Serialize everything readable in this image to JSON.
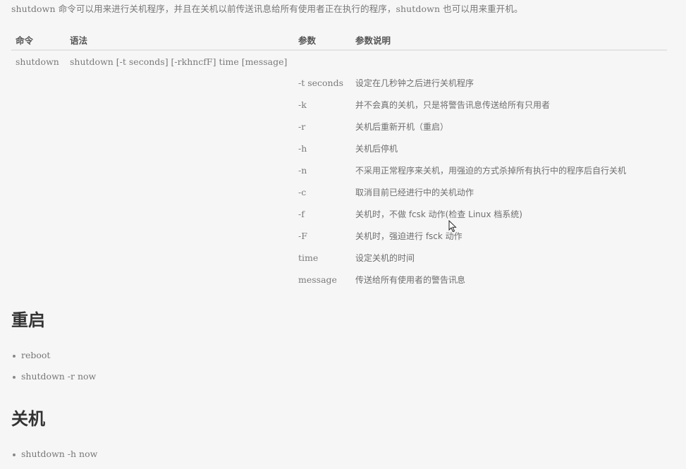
{
  "intro": "shutdown 命令可以用来进行关机程序，并且在关机以前传送讯息给所有使用者正在执行的程序，shutdown 也可以用来重开机。",
  "table": {
    "headers": [
      "命令",
      "语法",
      "参数",
      "参数说明"
    ],
    "command": "shutdown",
    "syntax": "shutdown [-t seconds] [-rkhncfF] time [message]",
    "params": [
      {
        "param": "-t seconds",
        "desc": "设定在几秒钟之后进行关机程序"
      },
      {
        "param": "-k",
        "desc": "并不会真的关机，只是将警告讯息传送给所有只用者"
      },
      {
        "param": "-r",
        "desc": "关机后重新开机（重启）"
      },
      {
        "param": "-h",
        "desc": "关机后停机"
      },
      {
        "param": "-n",
        "desc": "不采用正常程序来关机，用强迫的方式杀掉所有执行中的程序后自行关机"
      },
      {
        "param": "-c",
        "desc": "取消目前已经进行中的关机动作"
      },
      {
        "param": "-f",
        "desc": "关机时，不做 fcsk 动作(检查 Linux 档系统)"
      },
      {
        "param": "-F",
        "desc": "关机时，强迫进行 fsck 动作"
      },
      {
        "param": "time",
        "desc": "设定关机的时间"
      },
      {
        "param": "message",
        "desc": "传送给所有使用者的警告讯息"
      }
    ]
  },
  "reboot_section": {
    "heading": "重启",
    "items": [
      "reboot",
      "shutdown -r now"
    ]
  },
  "shutdown_section": {
    "heading": "关机",
    "items": [
      "shutdown -h now"
    ]
  },
  "cursor_icon": "mouse-pointer-icon"
}
